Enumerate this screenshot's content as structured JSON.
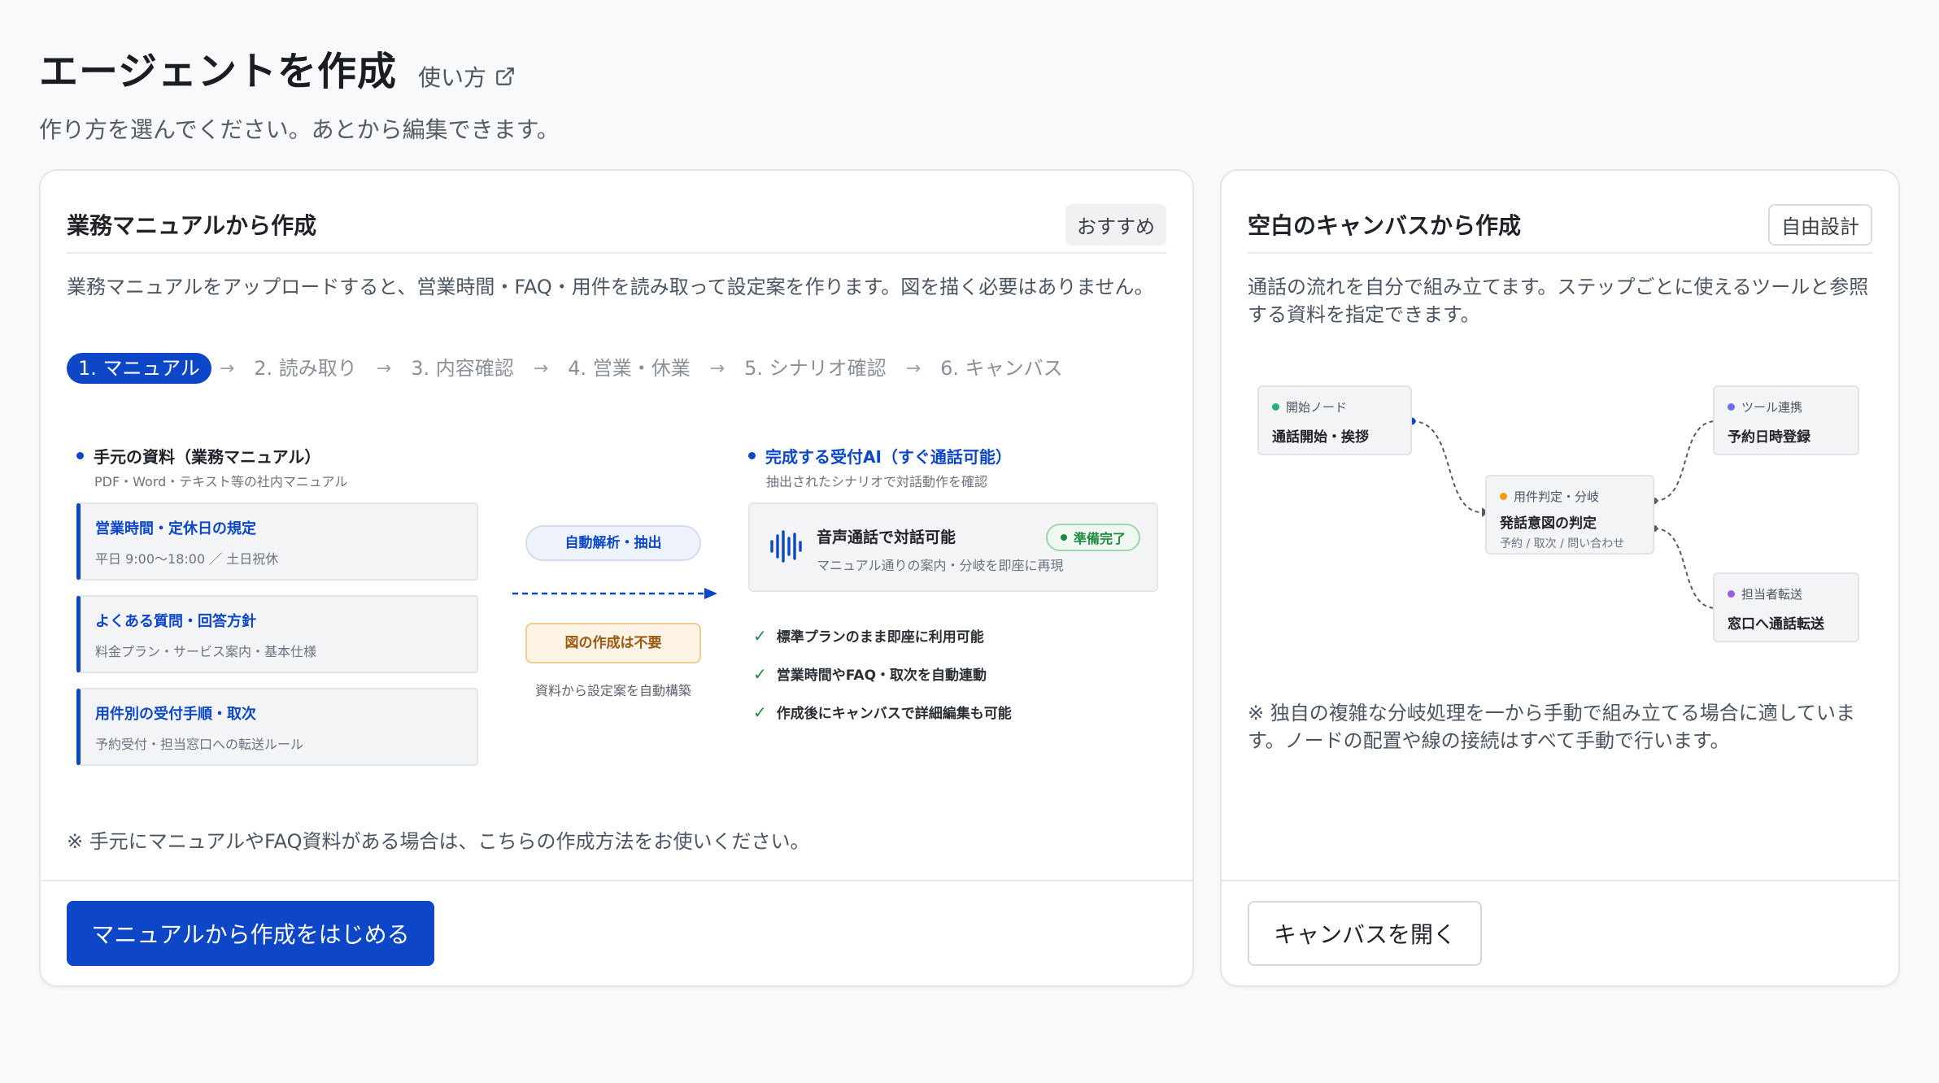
{
  "header": {
    "title": "エージェントを作成",
    "howto_label": "使い方",
    "subtitle": "作り方を選んでください。あとから編集できます。"
  },
  "manual_card": {
    "title": "業務マニュアルから作成",
    "badge": "おすすめ",
    "description": "業務マニュアルをアップロードすると、営業時間・FAQ・用件を読み取って設定案を作ります。図を描く必要はありません。",
    "steps": [
      "1. マニュアル",
      "2. 読み取り",
      "3. 内容確認",
      "4. 営業・休業",
      "5. シナリオ確認",
      "6. キャンバス"
    ],
    "source": {
      "title": "手元の資料（業務マニュアル）",
      "subtitle": "PDF・Word・テキスト等の社内マニュアル",
      "docs": [
        {
          "title": "営業時間・定休日の規定",
          "detail": "平日 9:00〜18:00 ／ 土日祝休"
        },
        {
          "title": "よくある質問・回答方針",
          "detail": "料金プラン・サービス案内・基本仕様"
        },
        {
          "title": "用件別の受付手順・取次",
          "detail": "予約受付・担当窓口への転送ルール"
        }
      ]
    },
    "process": {
      "auto_label": "自動解析・抽出",
      "no_diagram_label": "図の作成は不要",
      "caption": "資料から設定案を自動構築"
    },
    "result": {
      "title": "完成する受付AI（すぐ通話可能）",
      "subtitle": "抽出されたシナリオで対話動作を確認",
      "voice_title": "音声通話で対話可能",
      "voice_subtitle": "マニュアル通りの案内・分岐を即座に再現",
      "ready_badge": "準備完了",
      "checks": [
        "標準プランのまま即座に利用可能",
        "営業時間やFAQ・取次を自動連動",
        "作成後にキャンバスで詳細編集も可能"
      ]
    },
    "note": "※ 手元にマニュアルやFAQ資料がある場合は、こちらの作成方法をお使いください。",
    "cta_label": "マニュアルから作成をはじめる"
  },
  "canvas_card": {
    "title": "空白のキャンバスから作成",
    "badge": "自由設計",
    "description": "通話の流れを自分で組み立てます。ステップごとに使えるツールと参照する資料を指定できます。",
    "nodes": {
      "start": {
        "tag": "開始ノード",
        "name": "通話開始・挨拶",
        "color": "#22b07d"
      },
      "branch": {
        "tag": "用件判定・分岐",
        "name": "発話意図の判定",
        "sub": "予約 / 取次 / 問い合わせ",
        "color": "#f59e0b"
      },
      "tool": {
        "tag": "ツール連携",
        "name": "予約日時登録",
        "color": "#6b6ef0"
      },
      "transfer": {
        "tag": "担当者転送",
        "name": "窓口へ通話転送",
        "color": "#9b5de5"
      }
    },
    "note": "※ 独自の複雑な分岐処理を一から手動で組み立てる場合に適しています。ノードの配置や線の接続はすべて手動で行います。",
    "cta_label": "キャンバスを開く"
  },
  "colors": {
    "primary": "#0d47c8",
    "ready_green": "#1f8a3d",
    "warning_orange": "#9a5b10"
  }
}
